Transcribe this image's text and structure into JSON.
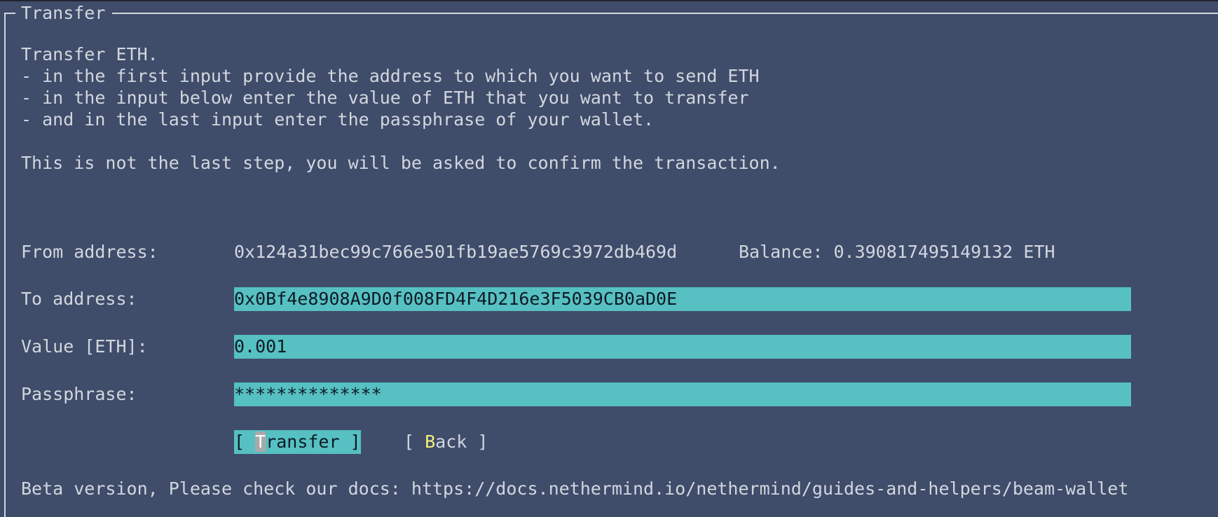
{
  "window": {
    "title": "Transfer"
  },
  "instructions": {
    "lines": [
      "Transfer ETH.",
      "- in the first input provide the address to which you want to send ETH",
      "- in the input below enter the value of ETH that you want to transfer",
      "- and in the last input enter the passphrase of your wallet."
    ],
    "note": "This is not the last step, you will be asked to confirm the transaction."
  },
  "form": {
    "from_label": "From address:",
    "from_value": "0x124a31bec99c766e501fb19ae5769c3972db469d",
    "balance_text": "Balance: 0.390817495149132 ETH",
    "to_label": "To address:",
    "to_value": "0x0Bf4e8908A9D0f008FD4F4D216e3F5039CB0aD0E",
    "amount_label": "Value [ETH]:",
    "amount_value": "0.001",
    "passphrase_label": "Passphrase:",
    "passphrase_value": "**************"
  },
  "buttons": {
    "transfer": {
      "open": "[ ",
      "hotkey": "T",
      "rest": "ransfer ]"
    },
    "back": {
      "open": "[ ",
      "hotkey": "B",
      "rest": "ack ]"
    }
  },
  "footer": {
    "text": "Beta version, Please check our docs: https://docs.nethermind.io/nethermind/guides-and-helpers/beam-wallet"
  },
  "colors": {
    "background": "#3f4c6a",
    "text": "#d2d7de",
    "input_bg": "#56c0c2",
    "hotkey": "#f3f07a"
  }
}
